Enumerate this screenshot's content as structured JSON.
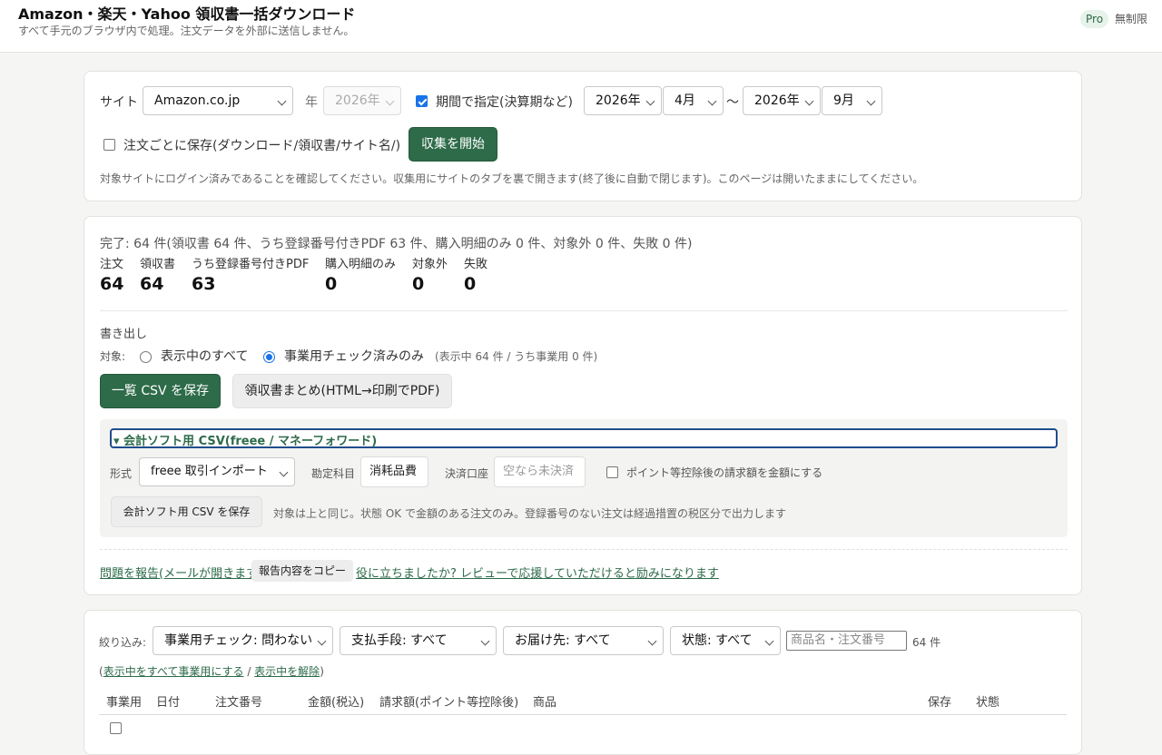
{
  "header": {
    "title": "Amazon・楽天・Yahoo 領収書一括ダウンロード",
    "subtitle": "すべて手元のブラウザ内で処理。注文データを外部に送信しません。",
    "plan_badge": "Pro",
    "plan_text": "無制限"
  },
  "settings": {
    "site_label": "サイト",
    "site_value": "Amazon.co.jp",
    "year_label": "年",
    "year_value": "2026年",
    "period_checkbox_label": "期間で指定(決算期など)",
    "period_checked": true,
    "from_year": "2026年",
    "from_month": "4月",
    "range_sep": "〜",
    "to_year": "2026年",
    "to_month": "9月",
    "save_per_order_label": "注文ごとに保存(ダウンロード/領収書/サイト名/)",
    "save_per_order_checked": false,
    "start_button": "収集を開始",
    "note": "対象サイトにログイン済みであることを確認してください。収集用にサイトのタブを裏で開きます(終了後に自動で閉じます)。このページは開いたままにしてください。"
  },
  "results": {
    "summary": "完了: 64 件(領収書 64 件、うち登録番号付きPDF 63 件、購入明細のみ 0 件、対象外 0 件、失敗 0 件)",
    "stats": [
      {
        "label": "注文",
        "value": "64"
      },
      {
        "label": "領収書",
        "value": "64"
      },
      {
        "label": "うち登録番号付きPDF",
        "value": "63"
      },
      {
        "label": "購入明細のみ",
        "value": "0"
      },
      {
        "label": "対象外",
        "value": "0"
      },
      {
        "label": "失敗",
        "value": "0"
      }
    ],
    "export_heading": "書き出し",
    "target_label": "対象:",
    "radio_all": "表示中のすべて",
    "radio_business": "事業用チェック済みのみ",
    "selected_radio": "business",
    "target_count": "(表示中 64 件 / うち事業用 0 件)",
    "csv_button": "一覧 CSV を保存",
    "receipts_button": "領収書まとめ(HTML→印刷でPDF)",
    "accounting": {
      "summary": "▾ 会計ソフト用 CSV(freee / マネーフォワード)",
      "format_label": "形式",
      "format_value": "freee 取引インポート",
      "account_label": "勘定科目",
      "account_value": "消耗品費",
      "payment_label": "決済口座",
      "payment_placeholder": "空なら未決済",
      "points_label": "ポイント等控除後の請求額を金額にする",
      "save_button": "会計ソフト用 CSV を保存",
      "note": "対象は上と同じ。状態 OK で金額のある注文のみ。登録番号のない注文は経過措置の税区分で出力します"
    },
    "report_link": "問題を報告(メールが開きます)",
    "copy_button": "報告内容をコピー",
    "review_link": "役に立ちましたか? レビューで応援していただけると励みになります"
  },
  "filters": {
    "label": "絞り込み:",
    "business_check": "事業用チェック: 問わない",
    "payment": "支払手段: すべて",
    "destination": "お届け先: すべて",
    "status": "状態: すべて",
    "search_placeholder": "商品名・注文番号",
    "count": "64 件",
    "bulk_open": "(",
    "bulk_mark": "表示中をすべて事業用にする",
    "bulk_sep": " / ",
    "bulk_unmark": "表示中を解除",
    "bulk_close": ")"
  },
  "table": {
    "columns": [
      "事業用",
      "日付",
      "注文番号",
      "金額(税込)",
      "請求額(ポイント等控除後)",
      "商品",
      "保存",
      "状態"
    ]
  },
  "colors": {
    "accent": "#2d6b49",
    "radio_checkbox": "#1a73e8",
    "focus_outline": "#1f4e8c"
  }
}
